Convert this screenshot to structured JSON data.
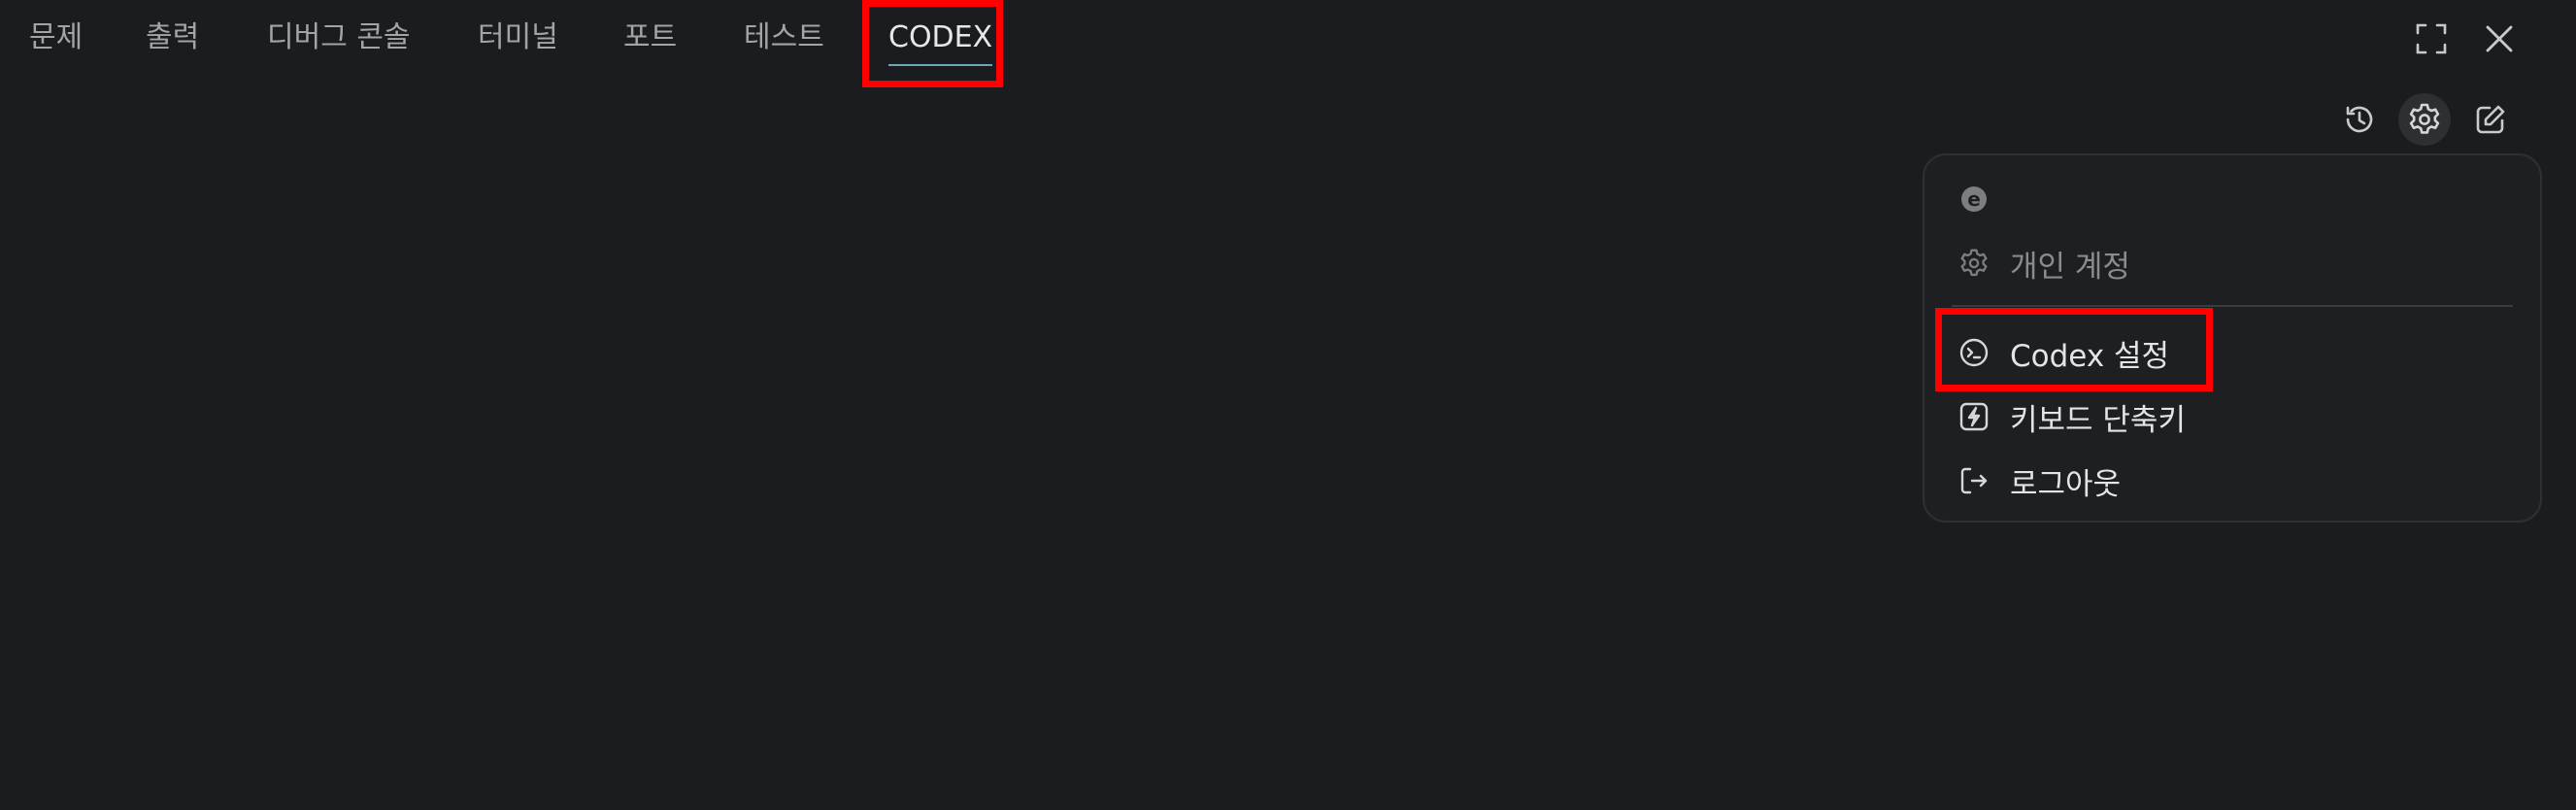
{
  "tabs": [
    {
      "label": "문제"
    },
    {
      "label": "출력"
    },
    {
      "label": "디버그 콘솔"
    },
    {
      "label": "터미널"
    },
    {
      "label": "포트"
    },
    {
      "label": "테스트"
    },
    {
      "label": "CODEX"
    }
  ],
  "active_tab": "CODEX",
  "window_controls": {
    "maximize_icon": "maximize-icon",
    "close_icon": "close-icon"
  },
  "toolbar": {
    "history_icon": "history-icon",
    "settings_icon": "gear-icon",
    "new_chat_icon": "edit-icon"
  },
  "menu": {
    "account_initial": "e",
    "personal_account": "개인 계정",
    "codex_settings": "Codex 설정",
    "keyboard_shortcuts": "키보드 단축키",
    "logout": "로그아웃"
  },
  "colors": {
    "background": "#1b1c1f",
    "menu_background": "#1e1f22",
    "accent_underline": "#6aa8b8",
    "annotation_red": "#ff0000"
  }
}
